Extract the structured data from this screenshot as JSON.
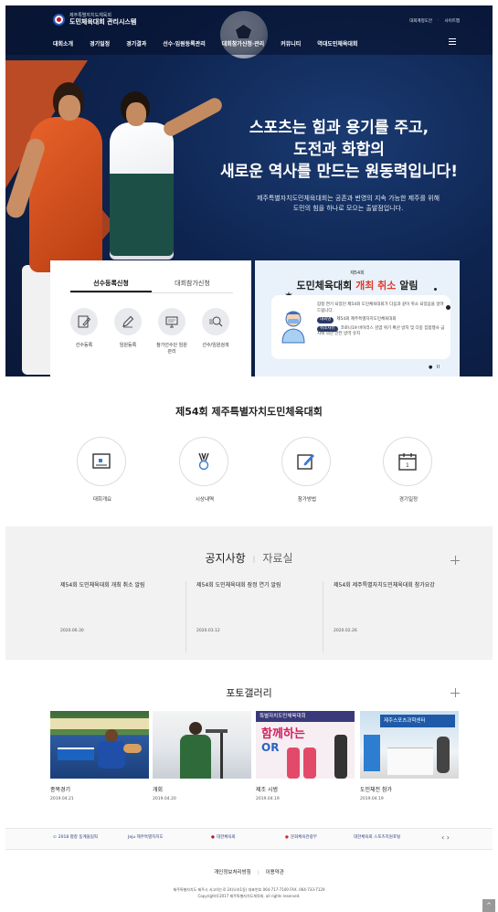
{
  "header": {
    "logo_small": "제주특별자치도체육회",
    "logo_main": "도민체육대회 관리시스템",
    "util_links": [
      "대회계정도안",
      "사이트맵"
    ],
    "nav": [
      "대회소개",
      "경기일정",
      "경기결과",
      "선수·임원등록관리",
      "대회참가신청·관리",
      "커뮤니티",
      "역대도민체육대회"
    ]
  },
  "hero": {
    "title_lines": [
      "스포츠는 힘과 용기를 주고,",
      "도전과 화합의",
      "새로운 역사를 만드는 원동력입니다!"
    ],
    "sub_lines": [
      "제주특별자치도민체육대회는 공존과 번영의 지속 가능한 제주를 위해",
      "도민의 힘을 하나로 모으는 출발점입니다."
    ]
  },
  "quick": {
    "tabs": [
      "선수등록신청",
      "대회참가신청"
    ],
    "items": [
      {
        "icon": "pencil-doc-icon",
        "label": "선수등록"
      },
      {
        "icon": "pencil-icon",
        "label": "임원등록"
      },
      {
        "icon": "monitor-icon",
        "label": "참가선수단 임원 관리"
      },
      {
        "icon": "search-people-icon",
        "label": "선수/임원검색"
      }
    ]
  },
  "popup": {
    "ordinal": "제54회",
    "title_plain": "도민체육대회",
    "title_red": "개최 취소",
    "title_end": "알림",
    "desc": "잠정 연기 되었던 제54회 도민체육대회가 다음과 같이 취소 되었음을 알려드립니다.",
    "rows": [
      {
        "tag": "대회명",
        "text": "제54회 제주특별자치도민체육대회"
      },
      {
        "tag": "취소사유",
        "text": "코로나19 바이러스 감염 위기 확산 방지 및 다중 집합행사 금지에 의한 안전 방역 유지"
      }
    ],
    "pager": [
      "●",
      "II"
    ]
  },
  "section1": {
    "title": "제54회 제주특별자치도민체육대회",
    "features": [
      {
        "icon": "document-icon",
        "label": "대회개요"
      },
      {
        "icon": "medal-icon",
        "label": "시상내역"
      },
      {
        "icon": "edit-icon",
        "label": "참가방법"
      },
      {
        "icon": "calendar-icon",
        "label": "경기일정"
      }
    ]
  },
  "notices": {
    "tab_active": "공지사항",
    "tab_other": "자료실",
    "items": [
      {
        "title": "제54회 도민체육대회 개최 취소 알림",
        "date": "2020.06.30"
      },
      {
        "title": "제54회 도민체육대회 잠정 연기 알림",
        "date": "2020.03.12"
      },
      {
        "title": "제54회 제주특별자치도민체육대회 참가요강",
        "date": "2020.02.26"
      }
    ]
  },
  "gallery": {
    "title": "포토갤러리",
    "items": [
      {
        "caption": "종목경기",
        "date": "2019.04.21"
      },
      {
        "caption": "개회",
        "date": "2019.04.20"
      },
      {
        "caption": "제조 시범",
        "date": "2019.04.19"
      },
      {
        "caption": "도민체전 참가",
        "date": "2019.04.19"
      }
    ],
    "image_text": {
      "banner3_top": "특별자치도민체육대회",
      "banner3_mid": "함께하는",
      "banner3_bot": "OR",
      "banner4": "제주스포츠과학센터"
    }
  },
  "partners": {
    "logos": [
      "2018 평창 동계올림픽",
      "Jeju 제주특별자치도",
      "대한체육회",
      "문화체육관광부",
      "대한체육회 스포츠지원포털"
    ],
    "arrows": "‹ ›"
  },
  "footer": {
    "links": [
      "개인정보처리방침",
      "이용약관"
    ],
    "address": "제주특별자치도 제주시 서고하는로 24(오라1동) 대표번호 064-717-7100  FAX. 064-733-7129",
    "copyright": "Copyright©2017 제주특별자치도체육회. all rights reserved.",
    "top_button": "^"
  },
  "colors": {
    "accent_red": "#e23a2a",
    "navy": "#0e2450",
    "orange": "#d9531e"
  }
}
